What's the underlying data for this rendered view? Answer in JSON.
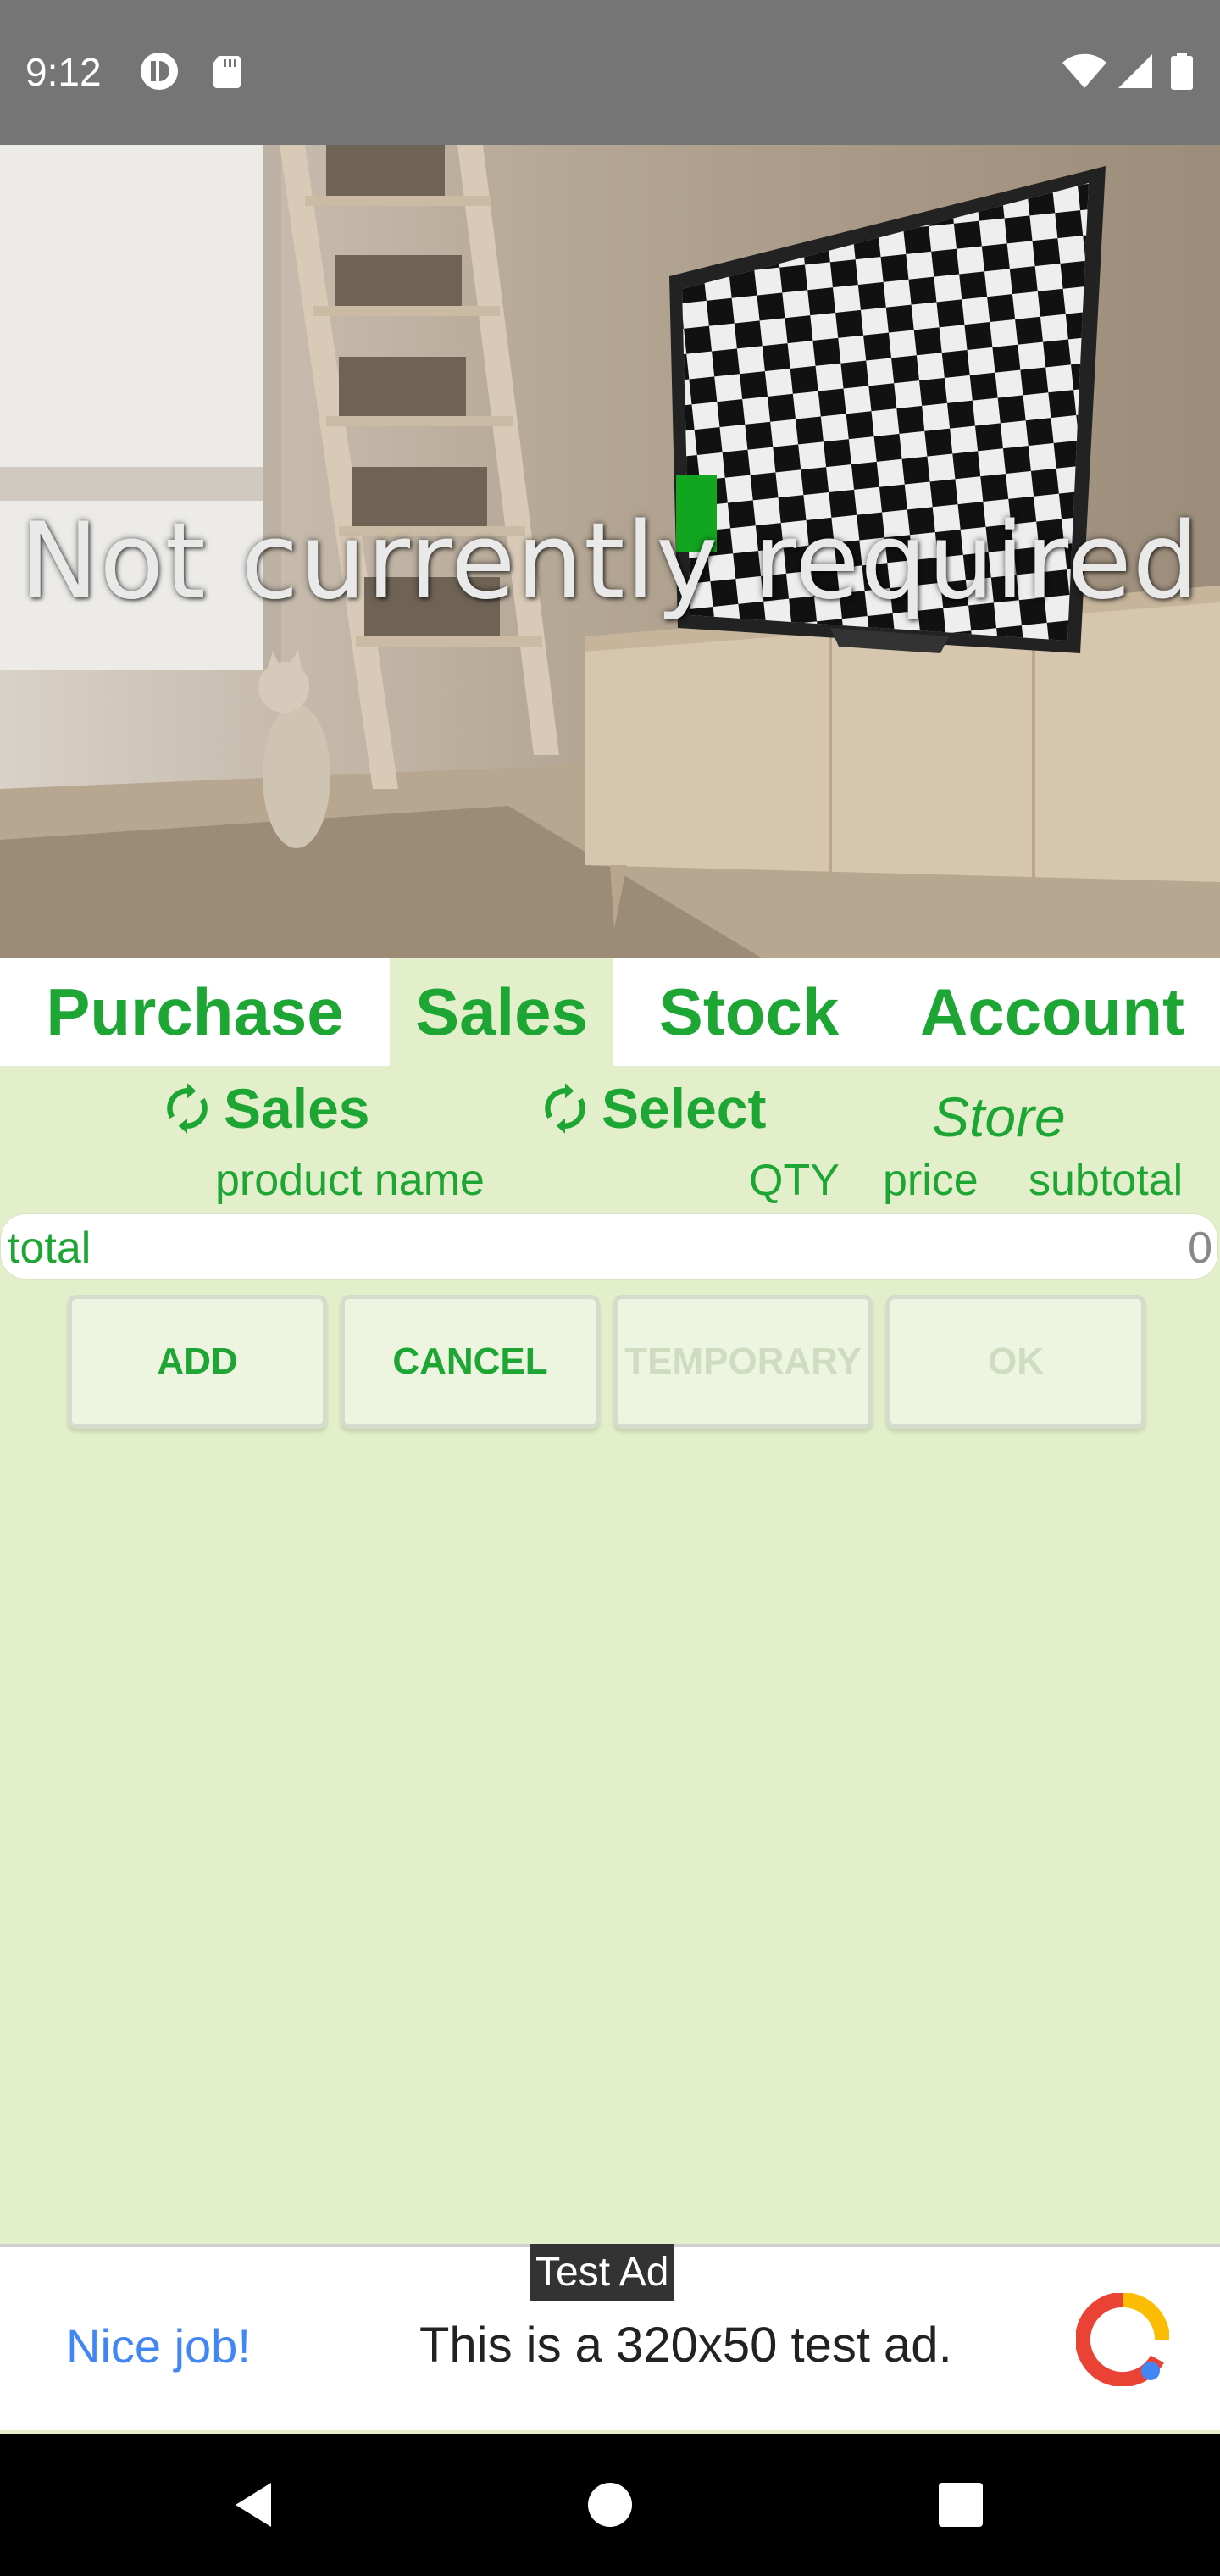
{
  "status_bar": {
    "time": "9:12",
    "icons": [
      "mobile-data-saver-icon",
      "sd-card-icon",
      "wifi-icon",
      "cell-signal-icon",
      "battery-icon"
    ]
  },
  "hero": {
    "caption": "Not currently required"
  },
  "tabs": [
    {
      "label": "Purchase",
      "active": false
    },
    {
      "label": "Sales",
      "active": true
    },
    {
      "label": "Stock",
      "active": false
    },
    {
      "label": "Account",
      "active": false
    }
  ],
  "sub_header": {
    "sales_button": "Sales",
    "select_button": "Select",
    "store_label": "Store"
  },
  "columns": {
    "product_name": "product name",
    "qty": "QTY",
    "price": "price",
    "subtotal": "subtotal"
  },
  "total": {
    "label": "total",
    "value": "0"
  },
  "actions": {
    "add": "ADD",
    "cancel": "CANCEL",
    "temporary": "TEMPORARY",
    "ok": "OK"
  },
  "ad": {
    "tag": "Test Ad",
    "cta": "Nice job!",
    "text": "This is a 320x50 test ad."
  },
  "colors": {
    "accent_green": "#1ea635",
    "background": "#e2efca",
    "disabled_text": "#cfdcc0"
  },
  "nav_bar": {
    "icons": [
      "back-icon",
      "home-icon",
      "recents-icon"
    ]
  }
}
